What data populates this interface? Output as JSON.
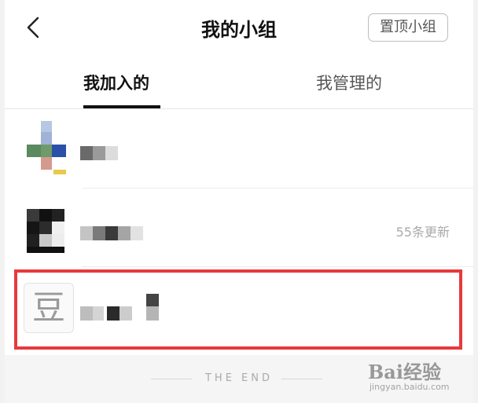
{
  "header": {
    "title": "我的小组",
    "pin_button": "置顶小组"
  },
  "tabs": [
    {
      "label": "我加入的",
      "active": true
    },
    {
      "label": "我管理的",
      "active": false
    }
  ],
  "groups": [
    {
      "updates": ""
    },
    {
      "updates": "55条更新"
    },
    {
      "avatar_char": "豆",
      "updates": ""
    }
  ],
  "footer": {
    "end_text": "THE END"
  },
  "watermark": {
    "main": "Bai经验",
    "sub": "jingyan.baidu.com"
  },
  "colors": {
    "highlight": "#e8393b",
    "background": "#ffffff",
    "secondary_text": "#aaaaaa"
  }
}
